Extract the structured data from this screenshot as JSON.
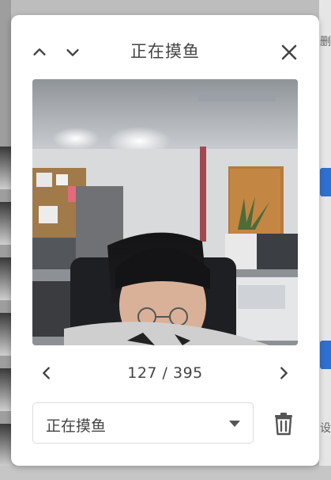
{
  "dialog": {
    "title": "正在摸鱼",
    "counter": "127 / 395",
    "category_select": {
      "value": "正在摸鱼"
    }
  },
  "background": {
    "right_text_top": "删",
    "right_text_bottom": "设"
  },
  "icons": {
    "up": "chevron-up-icon",
    "down": "chevron-down-icon",
    "close": "close-icon",
    "prev": "chevron-left-icon",
    "next": "chevron-right-icon",
    "caret": "dropdown-caret-icon",
    "delete": "trash-icon"
  },
  "colors": {
    "text": "#444444",
    "accent_badge": "#2f6fd1",
    "dialog_bg": "#ffffff"
  }
}
